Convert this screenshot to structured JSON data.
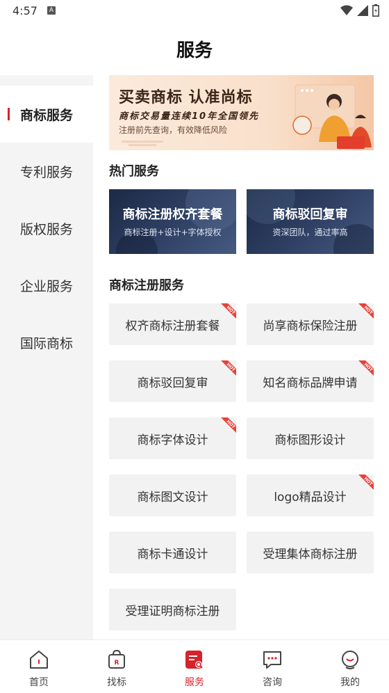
{
  "status_bar": {
    "time": "4:57",
    "notification": "A"
  },
  "header": {
    "title": "服务"
  },
  "sidebar": {
    "items": [
      {
        "label": "商标服务",
        "active": true
      },
      {
        "label": "专利服务",
        "active": false
      },
      {
        "label": "版权服务",
        "active": false
      },
      {
        "label": "企业服务",
        "active": false
      },
      {
        "label": "国际商标",
        "active": false
      }
    ]
  },
  "banner": {
    "title": "买卖商标 认准尚标",
    "subtitle": "商标交易量连续10年全国领先",
    "note": "注册前先查询，有效降低风险"
  },
  "hot": {
    "title": "热门服务",
    "cards": [
      {
        "title": "商标注册权齐套餐",
        "subtitle": "商标注册+设计+字体授权"
      },
      {
        "title": "商标驳回复审",
        "subtitle": "资深团队，通过率高"
      }
    ]
  },
  "registration": {
    "title": "商标注册服务",
    "hot_tag": "HOT",
    "items": [
      {
        "label": "权齐商标注册套餐",
        "hot": true
      },
      {
        "label": "尚享商标保险注册",
        "hot": true
      },
      {
        "label": "商标驳回复审",
        "hot": true
      },
      {
        "label": "知名商标品牌申请",
        "hot": true
      },
      {
        "label": "商标字体设计",
        "hot": true
      },
      {
        "label": "商标图形设计",
        "hot": false
      },
      {
        "label": "商标图文设计",
        "hot": false
      },
      {
        "label": "logo精品设计",
        "hot": true
      },
      {
        "label": "商标卡通设计",
        "hot": false
      },
      {
        "label": "受理集体商标注册",
        "hot": false
      },
      {
        "label": "受理证明商标注册",
        "hot": false
      }
    ]
  },
  "tabbar": {
    "items": [
      {
        "label": "首页",
        "icon": "home-icon",
        "active": false
      },
      {
        "label": "找标",
        "icon": "bag-icon",
        "active": false
      },
      {
        "label": "服务",
        "icon": "service-icon",
        "active": true
      },
      {
        "label": "咨询",
        "icon": "chat-icon",
        "active": false
      },
      {
        "label": "我的",
        "icon": "profile-icon",
        "active": false
      }
    ]
  },
  "colors": {
    "accent": "#d8222b",
    "sidebar_bg": "#f4f4f4",
    "button_bg": "#f2f2f2"
  }
}
